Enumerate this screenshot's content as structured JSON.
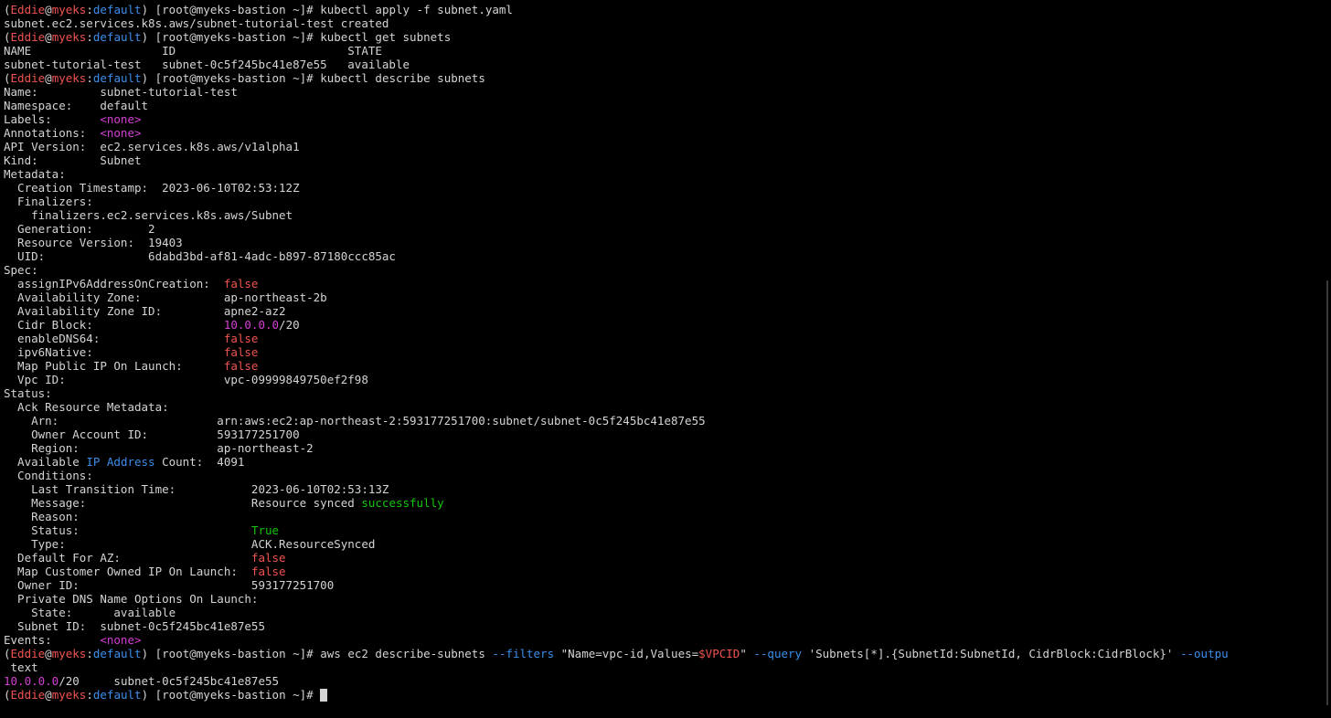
{
  "colors": {
    "text": "#d4d4d4",
    "red": "#ef5350",
    "magenta": "#d43fd4",
    "green": "#16c60c",
    "blue": "#3b8eea",
    "background": "#000000"
  },
  "terminal": {
    "lines": [
      [
        {
          "t": "("
        },
        {
          "t": "Eddie",
          "c": "red"
        },
        {
          "t": "@"
        },
        {
          "t": "myeks",
          "c": "red"
        },
        {
          "t": ":"
        },
        {
          "t": "default",
          "c": "blue"
        },
        {
          "t": ") [root@myeks-bastion ~]# kubectl apply -f subnet.yaml"
        }
      ],
      [
        {
          "t": "subnet.ec2.services.k8s.aws/subnet-tutorial-test created"
        }
      ],
      [
        {
          "t": "("
        },
        {
          "t": "Eddie",
          "c": "red"
        },
        {
          "t": "@"
        },
        {
          "t": "myeks",
          "c": "red"
        },
        {
          "t": ":"
        },
        {
          "t": "default",
          "c": "blue"
        },
        {
          "t": ") [root@myeks-bastion ~]# kubectl get subnets"
        }
      ],
      [
        {
          "t": "NAME                   ID                         STATE"
        }
      ],
      [
        {
          "t": "subnet-tutorial-test   subnet-0c5f245bc41e87e55   available"
        }
      ],
      [
        {
          "t": "("
        },
        {
          "t": "Eddie",
          "c": "red"
        },
        {
          "t": "@"
        },
        {
          "t": "myeks",
          "c": "red"
        },
        {
          "t": ":"
        },
        {
          "t": "default",
          "c": "blue"
        },
        {
          "t": ") [root@myeks-bastion ~]# kubectl describe subnets"
        }
      ],
      [
        {
          "t": "Name:         subnet-tutorial-test"
        }
      ],
      [
        {
          "t": "Namespace:    default"
        }
      ],
      [
        {
          "t": "Labels:       "
        },
        {
          "t": "<none>",
          "c": "magenta"
        }
      ],
      [
        {
          "t": "Annotations:  "
        },
        {
          "t": "<none>",
          "c": "magenta"
        }
      ],
      [
        {
          "t": "API Version:  ec2.services.k8s.aws/v1alpha1"
        }
      ],
      [
        {
          "t": "Kind:         Subnet"
        }
      ],
      [
        {
          "t": "Metadata:"
        }
      ],
      [
        {
          "t": "  Creation Timestamp:  2023-06-10T02:53:12Z"
        }
      ],
      [
        {
          "t": "  Finalizers:"
        }
      ],
      [
        {
          "t": "    finalizers.ec2.services.k8s.aws/Subnet"
        }
      ],
      [
        {
          "t": "  Generation:        2"
        }
      ],
      [
        {
          "t": "  Resource Version:  19403"
        }
      ],
      [
        {
          "t": "  UID:               6dabd3bd-af81-4adc-b897-87180ccc85ac"
        }
      ],
      [
        {
          "t": "Spec:"
        }
      ],
      [
        {
          "t": "  assignIPv6AddressOnCreation:  "
        },
        {
          "t": "false",
          "c": "red"
        }
      ],
      [
        {
          "t": "  Availability Zone:            ap-northeast-2b"
        }
      ],
      [
        {
          "t": "  Availability Zone ID:         apne2-az2"
        }
      ],
      [
        {
          "t": "  Cidr Block:                   "
        },
        {
          "t": "10.0.0.0",
          "c": "magenta"
        },
        {
          "t": "/20"
        }
      ],
      [
        {
          "t": "  enableDNS64:                  "
        },
        {
          "t": "false",
          "c": "red"
        }
      ],
      [
        {
          "t": "  ipv6Native:                   "
        },
        {
          "t": "false",
          "c": "red"
        }
      ],
      [
        {
          "t": "  Map Public IP On Launch:      "
        },
        {
          "t": "false",
          "c": "red"
        }
      ],
      [
        {
          "t": "  Vpc ID:                       vpc-09999849750ef2f98"
        }
      ],
      [
        {
          "t": "Status:"
        }
      ],
      [
        {
          "t": "  Ack Resource Metadata:"
        }
      ],
      [
        {
          "t": "    Arn:                       arn:aws:ec2:ap-northeast-2:593177251700:subnet/subnet-0c5f245bc41e87e55"
        }
      ],
      [
        {
          "t": "    Owner Account ID:          593177251700"
        }
      ],
      [
        {
          "t": "    Region:                    ap-northeast-2"
        }
      ],
      [
        {
          "t": "  Available "
        },
        {
          "t": "IP Address",
          "c": "blue"
        },
        {
          "t": " Count:  4091"
        }
      ],
      [
        {
          "t": "  Conditions:"
        }
      ],
      [
        {
          "t": "    Last Transition Time:           2023-06-10T02:53:13Z"
        }
      ],
      [
        {
          "t": "    Message:                        Resource synced "
        },
        {
          "t": "successfully",
          "c": "green"
        }
      ],
      [
        {
          "t": "    Reason:"
        }
      ],
      [
        {
          "t": "    Status:                         "
        },
        {
          "t": "True",
          "c": "green"
        }
      ],
      [
        {
          "t": "    Type:                           ACK.ResourceSynced"
        }
      ],
      [
        {
          "t": "  Default For AZ:                   "
        },
        {
          "t": "false",
          "c": "red"
        }
      ],
      [
        {
          "t": "  Map Customer Owned IP On Launch:  "
        },
        {
          "t": "false",
          "c": "red"
        }
      ],
      [
        {
          "t": "  Owner ID:                         593177251700"
        }
      ],
      [
        {
          "t": "  Private DNS Name Options On Launch:"
        }
      ],
      [
        {
          "t": "    State:      available"
        }
      ],
      [
        {
          "t": "  Subnet ID:  subnet-0c5f245bc41e87e55"
        }
      ],
      [
        {
          "t": "Events:       "
        },
        {
          "t": "<none>",
          "c": "magenta"
        }
      ],
      [
        {
          "t": "("
        },
        {
          "t": "Eddie",
          "c": "red"
        },
        {
          "t": "@"
        },
        {
          "t": "myeks",
          "c": "red"
        },
        {
          "t": ":"
        },
        {
          "t": "default",
          "c": "blue"
        },
        {
          "t": ") [root@myeks-bastion ~]# aws ec2 describe-subnets "
        },
        {
          "t": "--filters",
          "c": "blue"
        },
        {
          "t": " \"Name=vpc-id,Values="
        },
        {
          "t": "$VPCID",
          "c": "red"
        },
        {
          "t": "\" "
        },
        {
          "t": "--query",
          "c": "blue"
        },
        {
          "t": " 'Subnets[*].{SubnetId:SubnetId, CidrBlock:CidrBlock}' "
        },
        {
          "t": "--outpu",
          "c": "blue"
        }
      ],
      [
        {
          "t": " text"
        }
      ],
      [
        {
          "t": "10.0.0.0",
          "c": "magenta"
        },
        {
          "t": "/20     subnet-0c5f245bc41e87e55"
        }
      ],
      [
        {
          "t": "("
        },
        {
          "t": "Eddie",
          "c": "red"
        },
        {
          "t": "@"
        },
        {
          "t": "myeks",
          "c": "red"
        },
        {
          "t": ":"
        },
        {
          "t": "default",
          "c": "blue"
        },
        {
          "t": ") [root@myeks-bastion ~]# "
        }
      ]
    ]
  }
}
